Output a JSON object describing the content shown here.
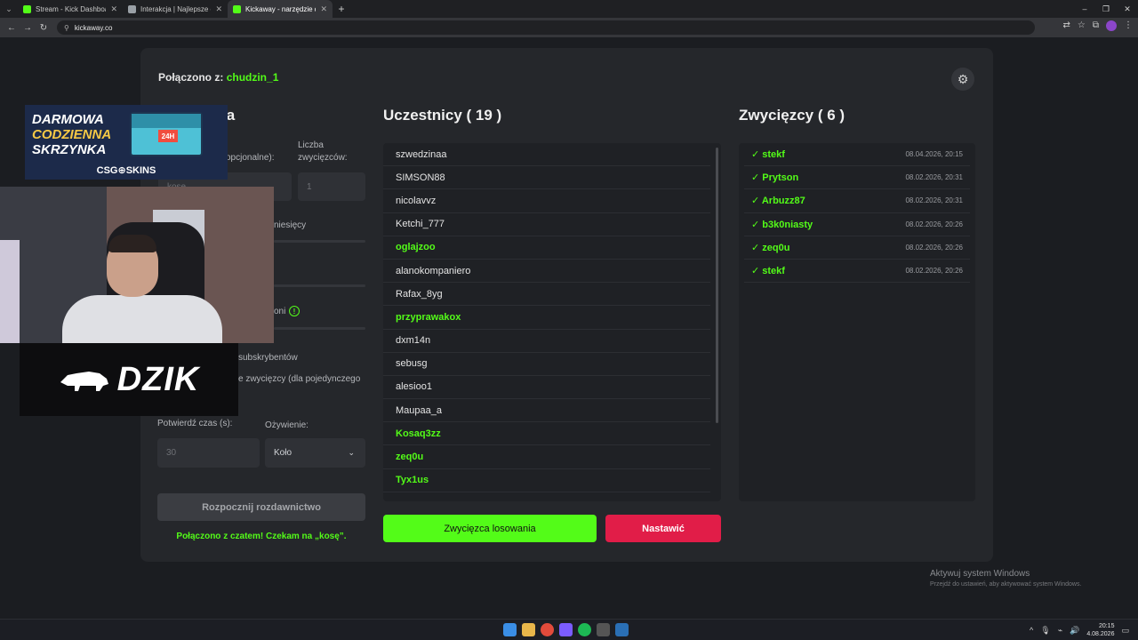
{
  "browser": {
    "tabs": [
      {
        "label": "Stream - Kick Dashboard",
        "color": "#53fc18",
        "active": false
      },
      {
        "label": "Interakcja | Najlepsze oprogram",
        "color": "#9aa0a6",
        "active": false
      },
      {
        "label": "Kickaway - narzędzie do rozdaw",
        "color": "#53fc18",
        "active": true
      }
    ],
    "url": "kickaway.co"
  },
  "header": {
    "connected_prefix": "Połączono z:",
    "connected_user": "chudzin_1"
  },
  "settings_col": {
    "title_visible": "ia",
    "keyword_label_visible": "opcjonalne):",
    "keyword_placeholder_visible": "kosę",
    "winners_label": "Liczba zwycięzców:",
    "winners_value": "1",
    "months_text_visible": "niesięcy",
    "option_text_visible": "oni",
    "subs_text_visible": "subskrybentów",
    "same_winner_text_visible": "e zwycięzcy (dla pojedynczego",
    "confirm_time_label": "Potwierdź czas (s):",
    "confirm_time_value": "30",
    "animation_label": "Ożywienie:",
    "animation_value": "Koło",
    "start_button": "Rozpocznij rozdawnictwo",
    "status": "Połączono z czatem! Czekam na „kosę”."
  },
  "participants": {
    "title": "Uczestnicy ( 19 )",
    "items": [
      {
        "name": "szwedzinaa",
        "highlight": false
      },
      {
        "name": "SIMSON88",
        "highlight": false
      },
      {
        "name": "nicolavvz",
        "highlight": false
      },
      {
        "name": "Ketchi_777",
        "highlight": false
      },
      {
        "name": "oglajzoo",
        "highlight": true
      },
      {
        "name": "alanokompaniero",
        "highlight": false
      },
      {
        "name": "Rafax_8yg",
        "highlight": false
      },
      {
        "name": "przyprawakox",
        "highlight": true
      },
      {
        "name": "dxm14n",
        "highlight": false
      },
      {
        "name": "sebusg",
        "highlight": false
      },
      {
        "name": "alesioo1",
        "highlight": false
      },
      {
        "name": "Maupaa_a",
        "highlight": false
      },
      {
        "name": "Kosaq3zz",
        "highlight": true
      },
      {
        "name": "zeq0u",
        "highlight": true
      },
      {
        "name": "Tyx1us",
        "highlight": true
      }
    ],
    "draw_button": "Zwycięzca losowania",
    "reset_button": "Nastawić"
  },
  "winners": {
    "title": "Zwycięzcy ( 6 )",
    "items": [
      {
        "name": "✓ stekf",
        "date": "08.04.2026, 20:15"
      },
      {
        "name": "✓ Prytson",
        "date": "08.02.2026, 20:31"
      },
      {
        "name": "✓ Arbuzz87",
        "date": "08.02.2026, 20:31"
      },
      {
        "name": "✓ b3k0niasty",
        "date": "08.02.2026, 20:26"
      },
      {
        "name": "✓ zeq0u",
        "date": "08.02.2026, 20:26"
      },
      {
        "name": "✓ stekf",
        "date": "08.02.2026, 20:26"
      }
    ]
  },
  "overlay": {
    "promo_lines": [
      "DARMOWA",
      "CODZIENNA",
      "SKRZYNKA"
    ],
    "promo_badge": "24H",
    "promo_brand": "CSG⊕SKINS",
    "sponsor": "DZIK"
  },
  "windows": {
    "activate_title": "Aktywuj system Windows",
    "activate_sub": "Przejdź do ustawień, aby aktywować system Windows.",
    "time": "20:15",
    "date": "4.08.2026"
  },
  "colors": {
    "accent": "#53fc18",
    "danger": "#e11d48"
  }
}
